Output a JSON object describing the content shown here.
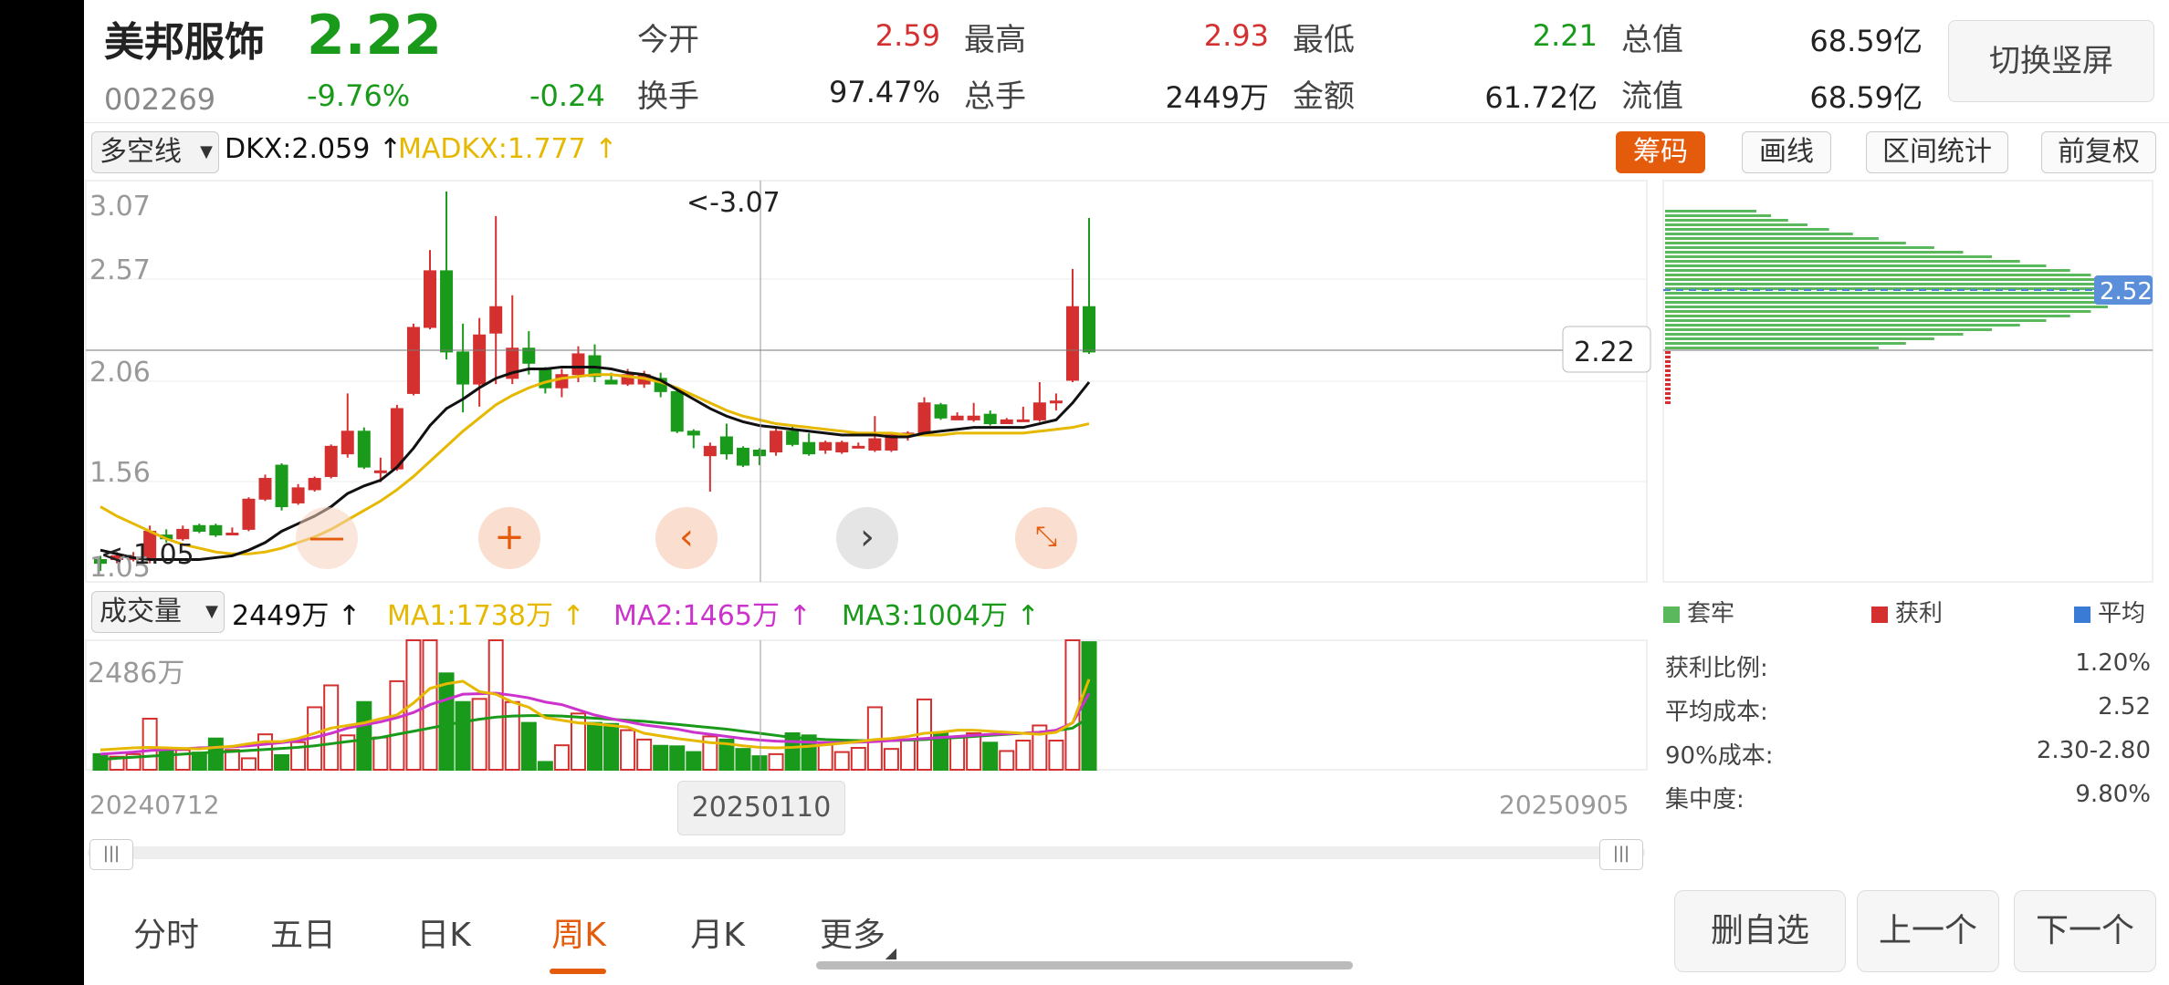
{
  "stock": {
    "name": "美邦服饰",
    "price": "2.22",
    "code": "002269",
    "change_pct": "-9.76%",
    "change_abs": "-0.24"
  },
  "quote": {
    "open_label": "今开",
    "open": "2.59",
    "high_label": "最高",
    "high": "2.93",
    "low_label": "最低",
    "low": "2.21",
    "mktcap_label": "总值",
    "mktcap": "68.59亿",
    "turnover_label": "换手",
    "turnover": "97.47%",
    "volume_label": "总手",
    "volume": "2449万",
    "amount_label": "金额",
    "amount": "61.72亿",
    "float_label": "流值",
    "float": "68.59亿"
  },
  "toolbar": {
    "switch_label": "切换竖屏",
    "indicator_select": "多空线",
    "dkx": "DKX:2.059",
    "madkx": "MADKX:1.777",
    "chip_label": "筹码",
    "draw_label": "画线",
    "range_label": "区间统计",
    "adjust_label": "前复权"
  },
  "main_chart": {
    "ticks": [
      "3.07",
      "2.57",
      "2.06",
      "1.56",
      "1.05"
    ],
    "high_marker": "<-3.07",
    "low_marker": "<-1.05",
    "cursor_price": "2.22",
    "chip_price": "2.52"
  },
  "volume_header": {
    "select": "成交量",
    "vol": "2449万",
    "ma1": "MA1:1738万",
    "ma2": "MA2:1465万",
    "ma3": "MA3:1004万"
  },
  "volume_chart": {
    "max_tick": "2486万",
    "date_start": "20240712",
    "date_cursor": "20250110",
    "date_end": "20250905"
  },
  "chips": {
    "legend_trapped": "套牢",
    "legend_profit": "获利",
    "legend_avg": "平均",
    "profit_ratio_label": "获利比例:",
    "profit_ratio": "1.20%",
    "avg_cost_label": "平均成本:",
    "avg_cost": "2.52",
    "cost90_label": "90%成本:",
    "cost90": "2.30-2.80",
    "concentration_label": "集中度:",
    "concentration": "9.80%"
  },
  "tabs": [
    "分时",
    "五日",
    "日K",
    "周K",
    "月K",
    "更多"
  ],
  "active_tab": "周K",
  "bottom_buttons": {
    "delete": "删自选",
    "prev": "上一个",
    "next": "下一个"
  },
  "icons": [
    "crosshair-icon",
    "chevron-left-icon",
    "chevron-right-icon",
    "shrink-icon",
    "scroll-handle-icon"
  ],
  "colors": {
    "up": "#d43030",
    "down": "#1a9a1a",
    "accent": "#e55b0c",
    "dkx": "#111111",
    "madkx": "#e6b800",
    "ma1": "#e6b800",
    "ma2": "#cc33cc",
    "ma3": "#1a9a1a"
  },
  "chart_data": {
    "type": "candlestick",
    "ylim": [
      1.05,
      3.07
    ],
    "candles": [
      [
        1.12,
        1.1,
        1.14,
        1.06
      ],
      [
        1.12,
        1.14,
        1.16,
        1.1
      ],
      [
        1.13,
        1.13,
        1.16,
        1.11
      ],
      [
        1.13,
        1.27,
        1.3,
        1.1
      ],
      [
        1.25,
        1.23,
        1.28,
        1.21
      ],
      [
        1.23,
        1.28,
        1.3,
        1.22
      ],
      [
        1.3,
        1.27,
        1.31,
        1.26
      ],
      [
        1.3,
        1.25,
        1.31,
        1.24
      ],
      [
        1.26,
        1.26,
        1.29,
        1.25
      ],
      [
        1.28,
        1.44,
        1.45,
        1.27
      ],
      [
        1.44,
        1.55,
        1.57,
        1.43
      ],
      [
        1.62,
        1.4,
        1.63,
        1.38
      ],
      [
        1.42,
        1.5,
        1.52,
        1.41
      ],
      [
        1.49,
        1.55,
        1.56,
        1.48
      ],
      [
        1.56,
        1.72,
        1.73,
        1.55
      ],
      [
        1.68,
        1.8,
        2.0,
        1.66
      ],
      [
        1.8,
        1.61,
        1.82,
        1.6
      ],
      [
        1.58,
        1.59,
        1.66,
        1.53
      ],
      [
        1.6,
        1.92,
        1.94,
        1.59
      ],
      [
        2.0,
        2.35,
        2.37,
        1.99
      ],
      [
        2.35,
        2.65,
        2.76,
        2.34
      ],
      [
        2.65,
        2.22,
        3.07,
        2.18
      ],
      [
        2.22,
        2.05,
        2.37,
        1.9
      ],
      [
        2.05,
        2.31,
        2.4,
        1.93
      ],
      [
        2.32,
        2.46,
        2.94,
        2.05
      ],
      [
        2.08,
        2.24,
        2.52,
        2.05
      ],
      [
        2.24,
        2.16,
        2.33,
        2.1
      ],
      [
        2.13,
        2.03,
        2.14,
        2.0
      ],
      [
        2.03,
        2.1,
        2.13,
        1.98
      ],
      [
        2.1,
        2.21,
        2.25,
        2.06
      ],
      [
        2.2,
        2.09,
        2.26,
        2.06
      ],
      [
        2.07,
        2.05,
        2.11,
        2.05
      ],
      [
        2.05,
        2.1,
        2.13,
        2.04
      ],
      [
        2.05,
        2.1,
        2.12,
        2.03
      ],
      [
        2.08,
        2.01,
        2.11,
        1.98
      ],
      [
        2.01,
        1.8,
        2.03,
        1.79
      ],
      [
        1.8,
        1.78,
        1.81,
        1.71
      ],
      [
        1.67,
        1.72,
        1.74,
        1.48
      ],
      [
        1.77,
        1.68,
        1.84,
        1.65
      ],
      [
        1.71,
        1.62,
        1.72,
        1.61
      ],
      [
        1.7,
        1.67,
        1.71,
        1.62
      ],
      [
        1.69,
        1.8,
        1.82,
        1.67
      ],
      [
        1.8,
        1.73,
        1.83,
        1.72
      ],
      [
        1.74,
        1.68,
        1.79,
        1.67
      ],
      [
        1.7,
        1.74,
        1.75,
        1.68
      ],
      [
        1.69,
        1.74,
        1.75,
        1.68
      ],
      [
        1.72,
        1.72,
        1.74,
        1.71
      ],
      [
        1.7,
        1.76,
        1.88,
        1.69
      ],
      [
        1.7,
        1.78,
        1.79,
        1.69
      ],
      [
        1.79,
        1.79,
        1.8,
        1.75
      ],
      [
        1.79,
        1.95,
        1.98,
        1.78
      ],
      [
        1.94,
        1.87,
        1.95,
        1.86
      ],
      [
        1.86,
        1.88,
        1.9,
        1.86
      ],
      [
        1.86,
        1.88,
        1.95,
        1.85
      ],
      [
        1.89,
        1.84,
        1.91,
        1.83
      ],
      [
        1.84,
        1.86,
        1.87,
        1.84
      ],
      [
        1.86,
        1.86,
        1.93,
        1.86
      ],
      [
        1.86,
        1.95,
        2.06,
        1.85
      ],
      [
        1.95,
        1.96,
        2.0,
        1.91
      ],
      [
        2.07,
        2.46,
        2.66,
        2.06
      ],
      [
        2.46,
        2.22,
        2.93,
        2.21
      ]
    ],
    "dkx": [
      1.17,
      1.15,
      1.13,
      1.12,
      1.12,
      1.12,
      1.12,
      1.13,
      1.14,
      1.17,
      1.21,
      1.27,
      1.31,
      1.35,
      1.4,
      1.47,
      1.51,
      1.54,
      1.61,
      1.71,
      1.83,
      1.92,
      1.97,
      2.03,
      2.08,
      2.11,
      2.13,
      2.13,
      2.14,
      2.14,
      2.14,
      2.13,
      2.11,
      2.1,
      2.07,
      2.02,
      1.97,
      1.92,
      1.88,
      1.85,
      1.83,
      1.82,
      1.81,
      1.8,
      1.79,
      1.78,
      1.78,
      1.78,
      1.77,
      1.77,
      1.79,
      1.8,
      1.81,
      1.82,
      1.82,
      1.82,
      1.82,
      1.84,
      1.86,
      1.95,
      2.06
    ],
    "madkx": [
      1.4,
      1.35,
      1.31,
      1.27,
      1.23,
      1.2,
      1.18,
      1.16,
      1.15,
      1.15,
      1.16,
      1.18,
      1.21,
      1.24,
      1.28,
      1.33,
      1.38,
      1.43,
      1.49,
      1.56,
      1.64,
      1.72,
      1.8,
      1.87,
      1.94,
      1.99,
      2.03,
      2.06,
      2.08,
      2.09,
      2.1,
      2.1,
      2.09,
      2.08,
      2.06,
      2.03,
      1.99,
      1.95,
      1.91,
      1.88,
      1.86,
      1.84,
      1.83,
      1.82,
      1.81,
      1.8,
      1.79,
      1.79,
      1.79,
      1.78,
      1.78,
      1.78,
      1.79,
      1.79,
      1.79,
      1.79,
      1.79,
      1.8,
      1.81,
      1.82,
      1.84
    ],
    "volume": [
      300,
      250,
      300,
      980,
      420,
      380,
      330,
      600,
      380,
      220,
      680,
      280,
      530,
      1200,
      1620,
      660,
      1300,
      620,
      1700,
      2486,
      2486,
      1850,
      1300,
      1360,
      2486,
      1300,
      900,
      150,
      470,
      1080,
      900,
      880,
      760,
      580,
      460,
      450,
      340,
      640,
      580,
      400,
      260,
      300,
      700,
      660,
      480,
      340,
      420,
      1200,
      400,
      580,
      1350,
      700,
      620,
      700,
      520,
      360,
      560,
      850,
      560,
      2486,
      2449
    ],
    "vol_ma1": [
      380,
      400,
      420,
      430,
      420,
      410,
      400,
      430,
      450,
      500,
      540,
      540,
      600,
      700,
      800,
      850,
      900,
      980,
      1050,
      1280,
      1560,
      1650,
      1700,
      1500,
      1450,
      1300,
      1200,
      1000,
      950,
      900,
      880,
      850,
      820,
      700,
      650,
      600,
      560,
      520,
      500,
      460,
      430,
      420,
      430,
      450,
      480,
      510,
      540,
      580,
      600,
      640,
      700,
      720,
      760,
      760,
      740,
      720,
      700,
      680,
      720,
      900,
      1738
    ],
    "vol_ma2": [
      300,
      320,
      340,
      370,
      390,
      400,
      420,
      430,
      440,
      460,
      490,
      520,
      560,
      620,
      700,
      800,
      860,
      920,
      1000,
      1100,
      1250,
      1350,
      1450,
      1460,
      1470,
      1430,
      1380,
      1300,
      1250,
      1150,
      1050,
      980,
      920,
      860,
      820,
      780,
      720,
      680,
      640,
      600,
      570,
      550,
      540,
      530,
      520,
      520,
      530,
      540,
      560,
      580,
      600,
      620,
      640,
      660,
      680,
      690,
      700,
      720,
      760,
      900,
      1465
    ],
    "vol_ma3": [
      200,
      220,
      240,
      260,
      280,
      300,
      320,
      340,
      350,
      370,
      390,
      410,
      430,
      460,
      500,
      540,
      580,
      620,
      680,
      740,
      800,
      860,
      920,
      970,
      1010,
      1030,
      1040,
      1040,
      1030,
      1010,
      990,
      970,
      950,
      930,
      900,
      870,
      840,
      810,
      780,
      740,
      700,
      660,
      620,
      600,
      580,
      570,
      560,
      560,
      560,
      570,
      580,
      600,
      620,
      640,
      660,
      680,
      700,
      720,
      750,
      800,
      1004
    ]
  }
}
